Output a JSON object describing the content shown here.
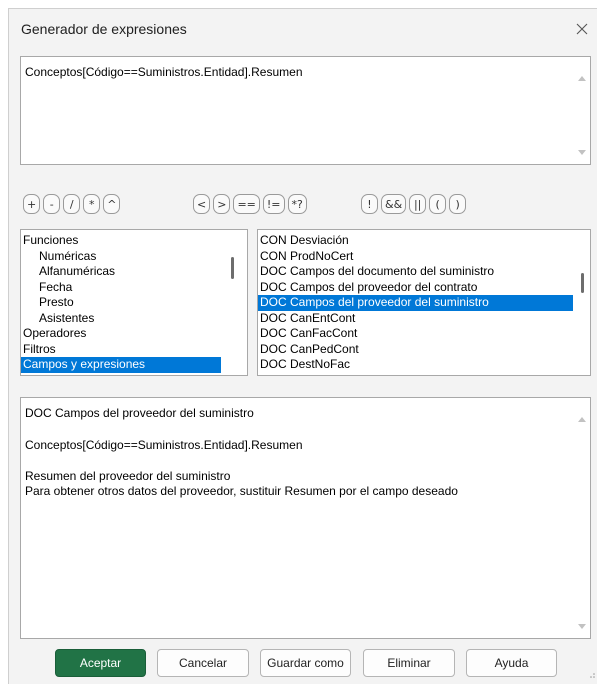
{
  "dialog": {
    "title": "Generador de expresiones"
  },
  "expression": {
    "value": "Conceptos[Código==Suministros.Entidad].Resumen"
  },
  "operators": {
    "group1": [
      "+",
      "-",
      "/",
      "*",
      "^"
    ],
    "group2": [
      "<",
      ">",
      "==",
      "!=",
      "*?"
    ],
    "group3": [
      "!",
      "&&",
      "||",
      "(",
      ")"
    ]
  },
  "categories": {
    "items": [
      {
        "label": "Funciones"
      },
      {
        "label": "Numéricas"
      },
      {
        "label": "Alfanuméricas"
      },
      {
        "label": "Fecha"
      },
      {
        "label": "Presto"
      },
      {
        "label": "Asistentes"
      },
      {
        "label": "Operadores"
      },
      {
        "label": "Filtros"
      },
      {
        "label": "Campos y expresiones"
      }
    ],
    "selected": "Campos y expresiones"
  },
  "fields": {
    "items": [
      {
        "label": "CON Desviación"
      },
      {
        "label": "CON ProdNoCert"
      },
      {
        "label": "DOC Campos del documento del suministro"
      },
      {
        "label": "DOC Campos del proveedor del contrato"
      },
      {
        "label": "DOC Campos del proveedor del suministro"
      },
      {
        "label": "DOC CanEntCont"
      },
      {
        "label": "DOC CanFacCont"
      },
      {
        "label": "DOC CanPedCont"
      },
      {
        "label": "DOC DestNoFac"
      }
    ],
    "selected": "DOC Campos del proveedor del suministro"
  },
  "description": {
    "heading": "DOC Campos del proveedor del suministro",
    "expression": "Conceptos[Código==Suministros.Entidad].Resumen",
    "line1": "Resumen del proveedor del suministro",
    "line2": "Para obtener otros datos del proveedor, sustituir Resumen por el campo deseado"
  },
  "buttons": {
    "accept": "Aceptar",
    "cancel": "Cancelar",
    "save_as": "Guardar como",
    "delete": "Eliminar",
    "help": "Ayuda"
  },
  "colors": {
    "accent_selection": "#0078d7",
    "primary_button": "#217346"
  },
  "icons": {
    "close": "close-icon",
    "scroll_up": "scroll-up-icon",
    "scroll_down": "scroll-down-icon",
    "resize_grip": "resize-grip-icon"
  }
}
